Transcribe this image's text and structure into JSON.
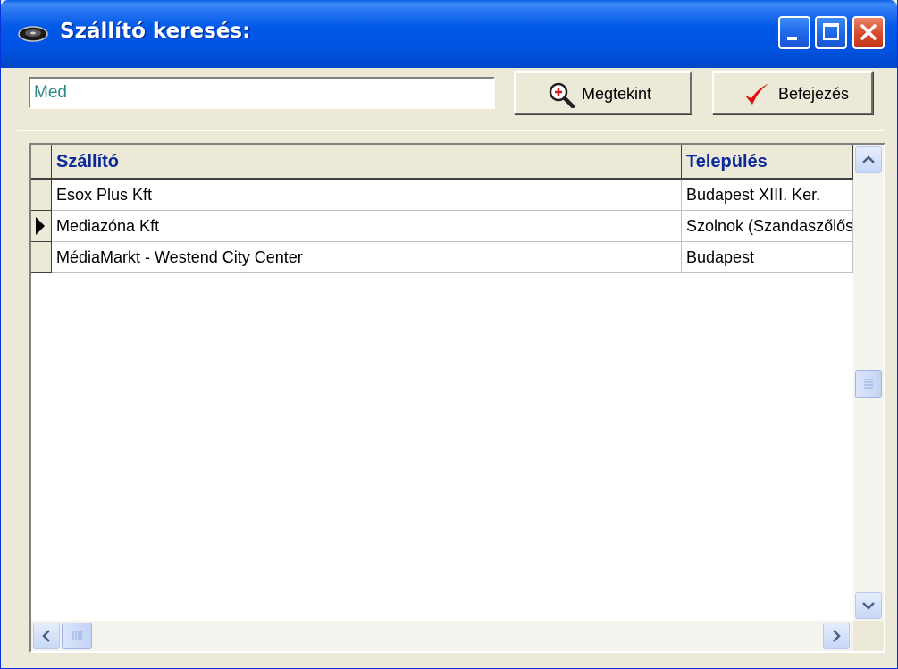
{
  "window": {
    "title": "Szállító keresés:",
    "title_icon": "tape-reel-icon",
    "controls": {
      "minimize": "minimize-icon",
      "maximize": "maximize-icon",
      "close": "close-icon"
    }
  },
  "search": {
    "value": "Med"
  },
  "buttons": {
    "view": {
      "label": "Megtekint",
      "icon": "magnifier-plus-icon"
    },
    "done": {
      "label": "Befejezés",
      "icon": "checkmark-icon"
    }
  },
  "grid": {
    "columns": [
      "Szállító",
      "Település"
    ],
    "rows": [
      {
        "supplier": "Esox Plus Kft",
        "city": "Budapest XIII. Ker.",
        "current": false
      },
      {
        "supplier": "Mediazóna Kft",
        "city": "Szolnok (Szandaszőlős)",
        "current": true
      },
      {
        "supplier": "MédiaMarkt - Westend City Center",
        "city": "Budapest",
        "current": false
      }
    ],
    "vertical_scroll_position": 0.5,
    "horizontal_scroll_position": 0
  },
  "colors": {
    "titlebar": "#0054E3",
    "face": "#ECE9D8",
    "header_text": "#0A2A9A",
    "input_text": "#2A8A8A",
    "close_button": "#D8492A",
    "check": "#E01010"
  }
}
